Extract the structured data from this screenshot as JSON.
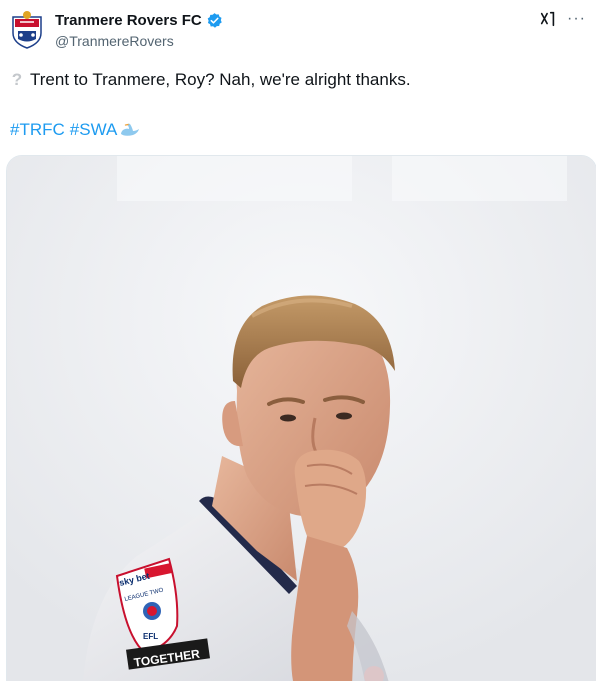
{
  "account": {
    "display_name": "Tranmere Rovers FC",
    "handle": "@TranmereRovers",
    "verified": true,
    "verified_color": "#1d9bf0"
  },
  "tweet": {
    "leading_emoji": "?",
    "text": "Trent to Tranmere, Roy? Nah, we're alright thanks.",
    "hashtags": [
      "#TRFC",
      "#SWA"
    ]
  },
  "image": {
    "sleeve_badge_sponsor": "sky bet",
    "sleeve_badge_league": "LEAGUE TWO",
    "sleeve_badge_org": "EFL",
    "sleeve_slogan": "TOGETHER"
  },
  "colors": {
    "accent": "#1d9bf0",
    "text": "#0f1419",
    "secondary": "#536471"
  }
}
